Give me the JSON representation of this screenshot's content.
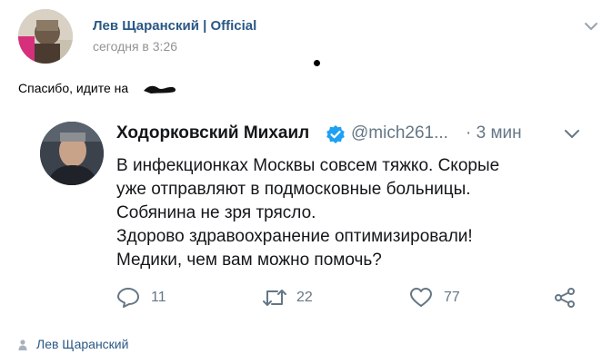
{
  "post": {
    "author": "Лев Щаранский | Official",
    "time": "сегодня в 3:26",
    "text": "Спасибо, идите на",
    "footer_author": "Лев Щаранский"
  },
  "tweet": {
    "name": "Ходорковский Михаил",
    "handle": "@mich261...",
    "time": "· 3 мин",
    "lines": [
      "В инфекционках Москвы совсем тяжко. Скорые",
      "уже отправляют в подмосковные больницы.",
      "Собянина не зря трясло.",
      "Здорово здравоохранение оптимизировали!",
      "Медики, чем вам можно помочь?"
    ],
    "replies": "11",
    "retweets": "22",
    "likes": "77"
  },
  "colors": {
    "vk_link": "#2a5885",
    "twitter_gray": "#657786",
    "verified_blue": "#1da1f2"
  },
  "icons": [
    "more-chevron-icon",
    "verified-badge-icon",
    "reply-icon",
    "retweet-icon",
    "like-icon",
    "share-icon",
    "user-icon"
  ]
}
